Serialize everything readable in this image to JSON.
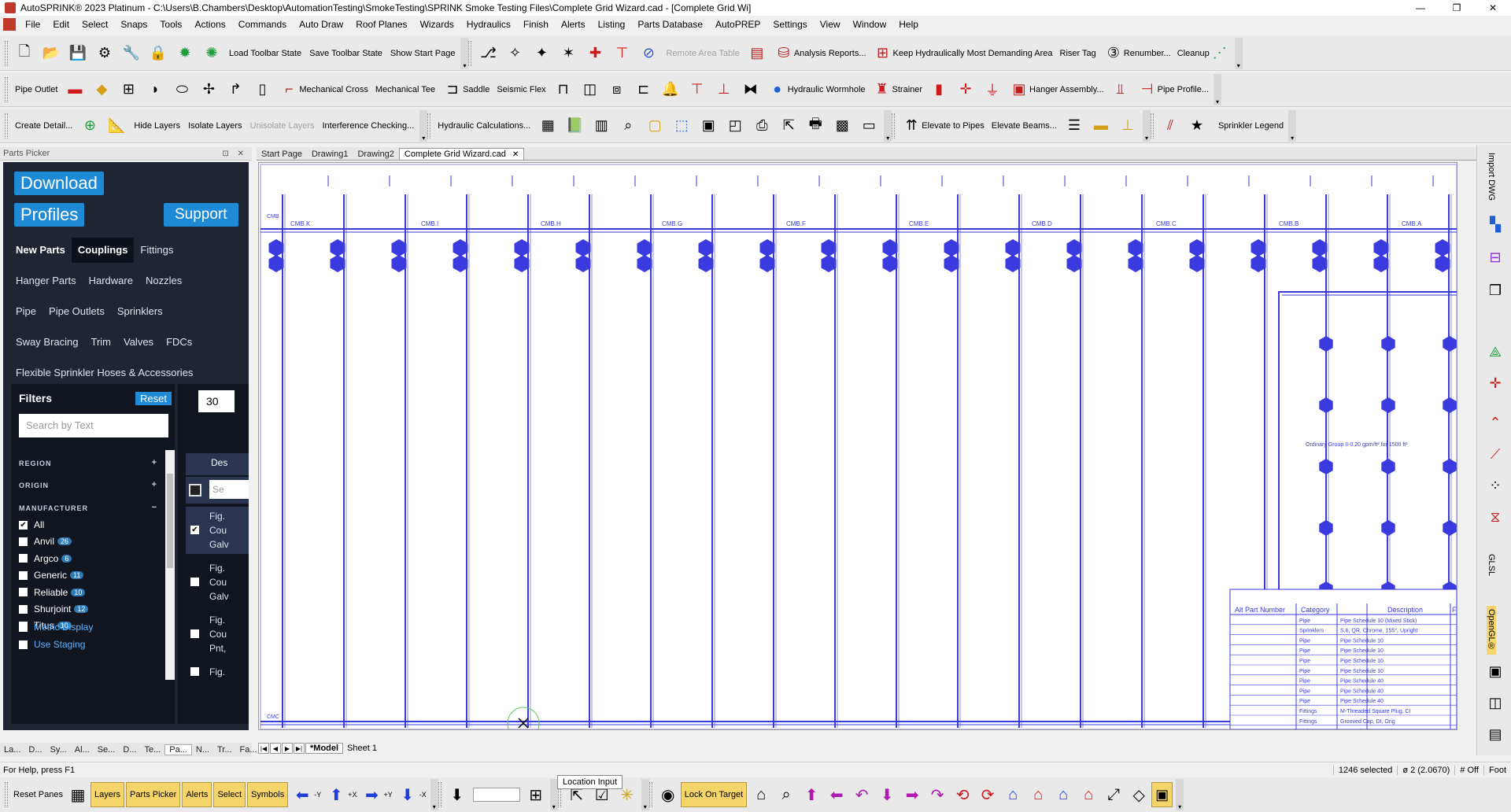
{
  "window": {
    "title": "AutoSPRINK® 2023 Platinum - C:\\Users\\B.Chambers\\Desktop\\AutomationTesting\\SmokeTesting\\SPRINK Smoke Testing Files\\Complete Grid Wizard.cad - [Complete Grid Wi]",
    "minimize": "—",
    "maximize": "❐",
    "close": "✕"
  },
  "menu": [
    "File",
    "Edit",
    "Select",
    "Snaps",
    "Tools",
    "Actions",
    "Commands",
    "Auto Draw",
    "Roof Planes",
    "Wizards",
    "Hydraulics",
    "Finish",
    "Alerts",
    "Listing",
    "Parts Database",
    "AutoPREP",
    "Settings",
    "View",
    "Window",
    "Help"
  ],
  "toolbar1": {
    "load_state": "Load Toolbar State",
    "save_state": "Save Toolbar State",
    "show_start": "Show Start Page",
    "remote_area": "Remote Area Table",
    "analysis": "Analysis Reports...",
    "keep_hydraulic": "Keep Hydraulically Most Demanding Area",
    "riser_tag": "Riser Tag",
    "renumber": "Renumber...",
    "cleanup": "Cleanup"
  },
  "toolbar2": {
    "pipe_outlet": "Pipe Outlet",
    "mech_cross": "Mechanical Cross",
    "mech_tee": "Mechanical Tee",
    "saddle": "Saddle",
    "seismic": "Seismic Flex",
    "wormhole": "Hydraulic Wormhole",
    "strainer": "Strainer",
    "hanger_assembly": "Hanger Assembly...",
    "pipe_profile": "Pipe Profile..."
  },
  "toolbar3": {
    "create_detail": "Create Detail...",
    "hide_layers": "Hide Layers",
    "isolate_layers": "Isolate Layers",
    "unisolate_layers": "Unisolate Layers",
    "interference": "Interference Checking...",
    "hydraulic_calcs": "Hydraulic Calculations...",
    "elevate_pipes": "Elevate to Pipes",
    "elevate_beams": "Elevate Beams...",
    "sprinkler_legend": "Sprinkler Legend"
  },
  "parts_picker": {
    "header": "Parts Picker",
    "header_ctrl": "⊡ ✕",
    "download": "Download",
    "profiles": "Profiles",
    "support": "Support",
    "tabs_row1": [
      "New Parts",
      "Couplings",
      "Fittings"
    ],
    "tabs_row2": [
      "Hanger Parts",
      "Hardware",
      "Nozzles"
    ],
    "tabs_row3": [
      "Pipe",
      "Pipe Outlets",
      "Sprinklers"
    ],
    "tabs_row4": [
      "Sway Bracing",
      "Trim",
      "Valves",
      "FDCs"
    ],
    "tabs_row5": [
      "Flexible Sprinkler Hoses & Accessories"
    ],
    "filters_title": "Filters",
    "reset": "Reset",
    "search_placeholder": "Search by Text",
    "region": "REGION",
    "origin": "ORIGIN",
    "manufacturer": "MANUFACTURER",
    "plus": "+",
    "minus": "−",
    "manufacturers": [
      {
        "name": "All",
        "count": "",
        "checked": true
      },
      {
        "name": "Anvil",
        "count": "26",
        "checked": false
      },
      {
        "name": "Argco",
        "count": "6",
        "checked": false
      },
      {
        "name": "Generic",
        "count": "11",
        "checked": false
      },
      {
        "name": "Reliable",
        "count": "10",
        "checked": false
      },
      {
        "name": "Shurjoint",
        "count": "12",
        "checked": false
      },
      {
        "name": "Titus",
        "count": "10",
        "checked": false
      }
    ],
    "metric_display": "Metric Display",
    "use_staging": "Use Staging",
    "per_page": "30",
    "results_header": "Des",
    "results_search": "Se",
    "results": [
      {
        "lines": [
          "Fig.",
          "Cou",
          "Galv"
        ],
        "checked": true
      },
      {
        "lines": [
          "Fig.",
          "Cou",
          "Galv"
        ],
        "checked": false
      },
      {
        "lines": [
          "Fig.",
          "Cou",
          "Pnt,"
        ],
        "checked": false
      },
      {
        "lines": [
          "Fig."
        ],
        "checked": false
      }
    ],
    "bottom_tabs": [
      "La...",
      "D...",
      "Sy...",
      "Al...",
      "Se...",
      "D...",
      "Te...",
      "Pa...",
      "N...",
      "Tr...",
      "Fa..."
    ]
  },
  "doc_tabs": [
    "Start Page",
    "Drawing1",
    "Drawing2",
    "Complete Grid Wizard.cad"
  ],
  "sheet_tabs": [
    "*Model",
    "Sheet 1"
  ],
  "drawing": {
    "branch_labels": [
      "CMB.K",
      "CMB.I",
      "CMB.H",
      "CMB.G",
      "CMB.F",
      "CMB.E",
      "CMB.D",
      "CMB.C",
      "CMB.B",
      "CMB.A"
    ],
    "left_labels": [
      "CMB",
      "CMC"
    ],
    "area_note": "Ordinary Group II-0.20 gpm/ft² for 1500 ft²",
    "table_headers": [
      "Alt Part Number",
      "Category",
      "Description",
      "Field"
    ],
    "table_rows": [
      {
        "category": "Pipe",
        "desc": "Pipe Schedule 10 (Mixed Stick)"
      },
      {
        "category": "Sprinklers",
        "desc": "S.6, QR, Chrome, 155°, Upright"
      },
      {
        "category": "Pipe",
        "desc": "Pipe Schedule 10"
      },
      {
        "category": "Pipe",
        "desc": "Pipe Schedule 10"
      },
      {
        "category": "Pipe",
        "desc": "Pipe Schedule 10"
      },
      {
        "category": "Pipe",
        "desc": "Pipe Schedule 10"
      },
      {
        "category": "Pipe",
        "desc": "Pipe Schedule 40"
      },
      {
        "category": "Pipe",
        "desc": "Pipe Schedule 40"
      },
      {
        "category": "Pipe",
        "desc": "Pipe Schedule 40"
      },
      {
        "category": "Fittings",
        "desc": "M-Threaded Square Plug, CI"
      },
      {
        "category": "Fittings",
        "desc": "Grooved Cap, DI, Orig"
      },
      {
        "category": "Fittings",
        "desc": "Grooved Cap, DI, Orig"
      }
    ]
  },
  "right_strip": {
    "import_dwg": "Import DWG",
    "glsl": "GLSL",
    "opengl": "OpenGL®"
  },
  "status": {
    "help": "For Help, press F1",
    "selected": "1246 selected",
    "diameter": "ø 2 (2.0670)",
    "snap": "# Off",
    "units": "Foot"
  },
  "location_input": "Location Input",
  "bottom_toolbar": {
    "reset_panes": "Reset Panes",
    "layers": "Layers",
    "parts_picker": "Parts Picker",
    "alerts": "Alerts",
    "select": "Select",
    "symbols": "Symbols",
    "minus_y": "-Y",
    "plus_x": "+X",
    "plus_y": "+Y",
    "minus_x": "-X",
    "lock_on_target": "Lock On Target"
  }
}
